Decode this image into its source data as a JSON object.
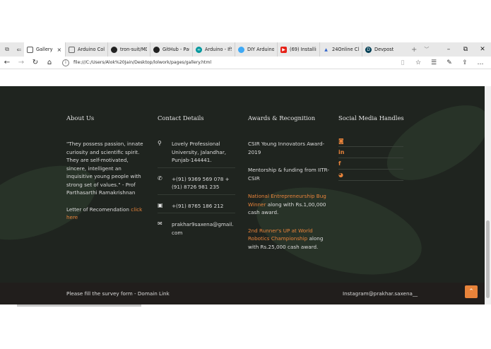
{
  "browser": {
    "tabs": [
      {
        "label": "Gallery",
        "active": true
      },
      {
        "label": "Arduino Colc"
      },
      {
        "label": "tron-suit/MD"
      },
      {
        "label": "GitHub - Pau"
      },
      {
        "label": "Arduino - IfS"
      },
      {
        "label": "DIY Arduino"
      },
      {
        "label": "(69) Installing"
      },
      {
        "label": "24Online Clie"
      },
      {
        "label": "Devpost"
      }
    ],
    "url": "file:///C:/Users/Alok%20Jain/Desktop/lolwork/pages/gallery.html"
  },
  "footer": {
    "about": {
      "heading": "About Us",
      "quote": "\"They possess passion, innate curiosity and scientific spirit. They are self-motivated, sincere, intelligent an inquisitive young people with strong set of values.\" - Prof Parthasarthi Ramakrishnan",
      "letter_text": "Letter of Recomendation ",
      "link_text": "click here"
    },
    "contact": {
      "heading": "Contact Details",
      "address": "Lovely Professional University, Jalandhar, Punjab-144441.",
      "phones": "+(91) 9369 569 078 +(91) 8726 981 235",
      "fax": "+(91) 8765 186 212",
      "email": "prakhar9saxena@gmail.com"
    },
    "awards": {
      "heading": "Awards & Recognition",
      "a1": "CSIR Young Innovators Award-2019",
      "a2": "Mentorship & funding from IITR-CSIR",
      "a3_link": "National Entrepreneurship Bug Winner",
      "a3_text": " along with Rs.1,00,000 cash award.",
      "a4_link": "2nd Runner's UP at World Robotics Championship",
      "a4_text": " along with Rs.25,000 cash award."
    },
    "social": {
      "heading": "Social Media Handles"
    },
    "bottom": {
      "survey": "Please fill the survey form - Domain Link",
      "instagram": "Instagram@prakhar.saxena__"
    }
  }
}
